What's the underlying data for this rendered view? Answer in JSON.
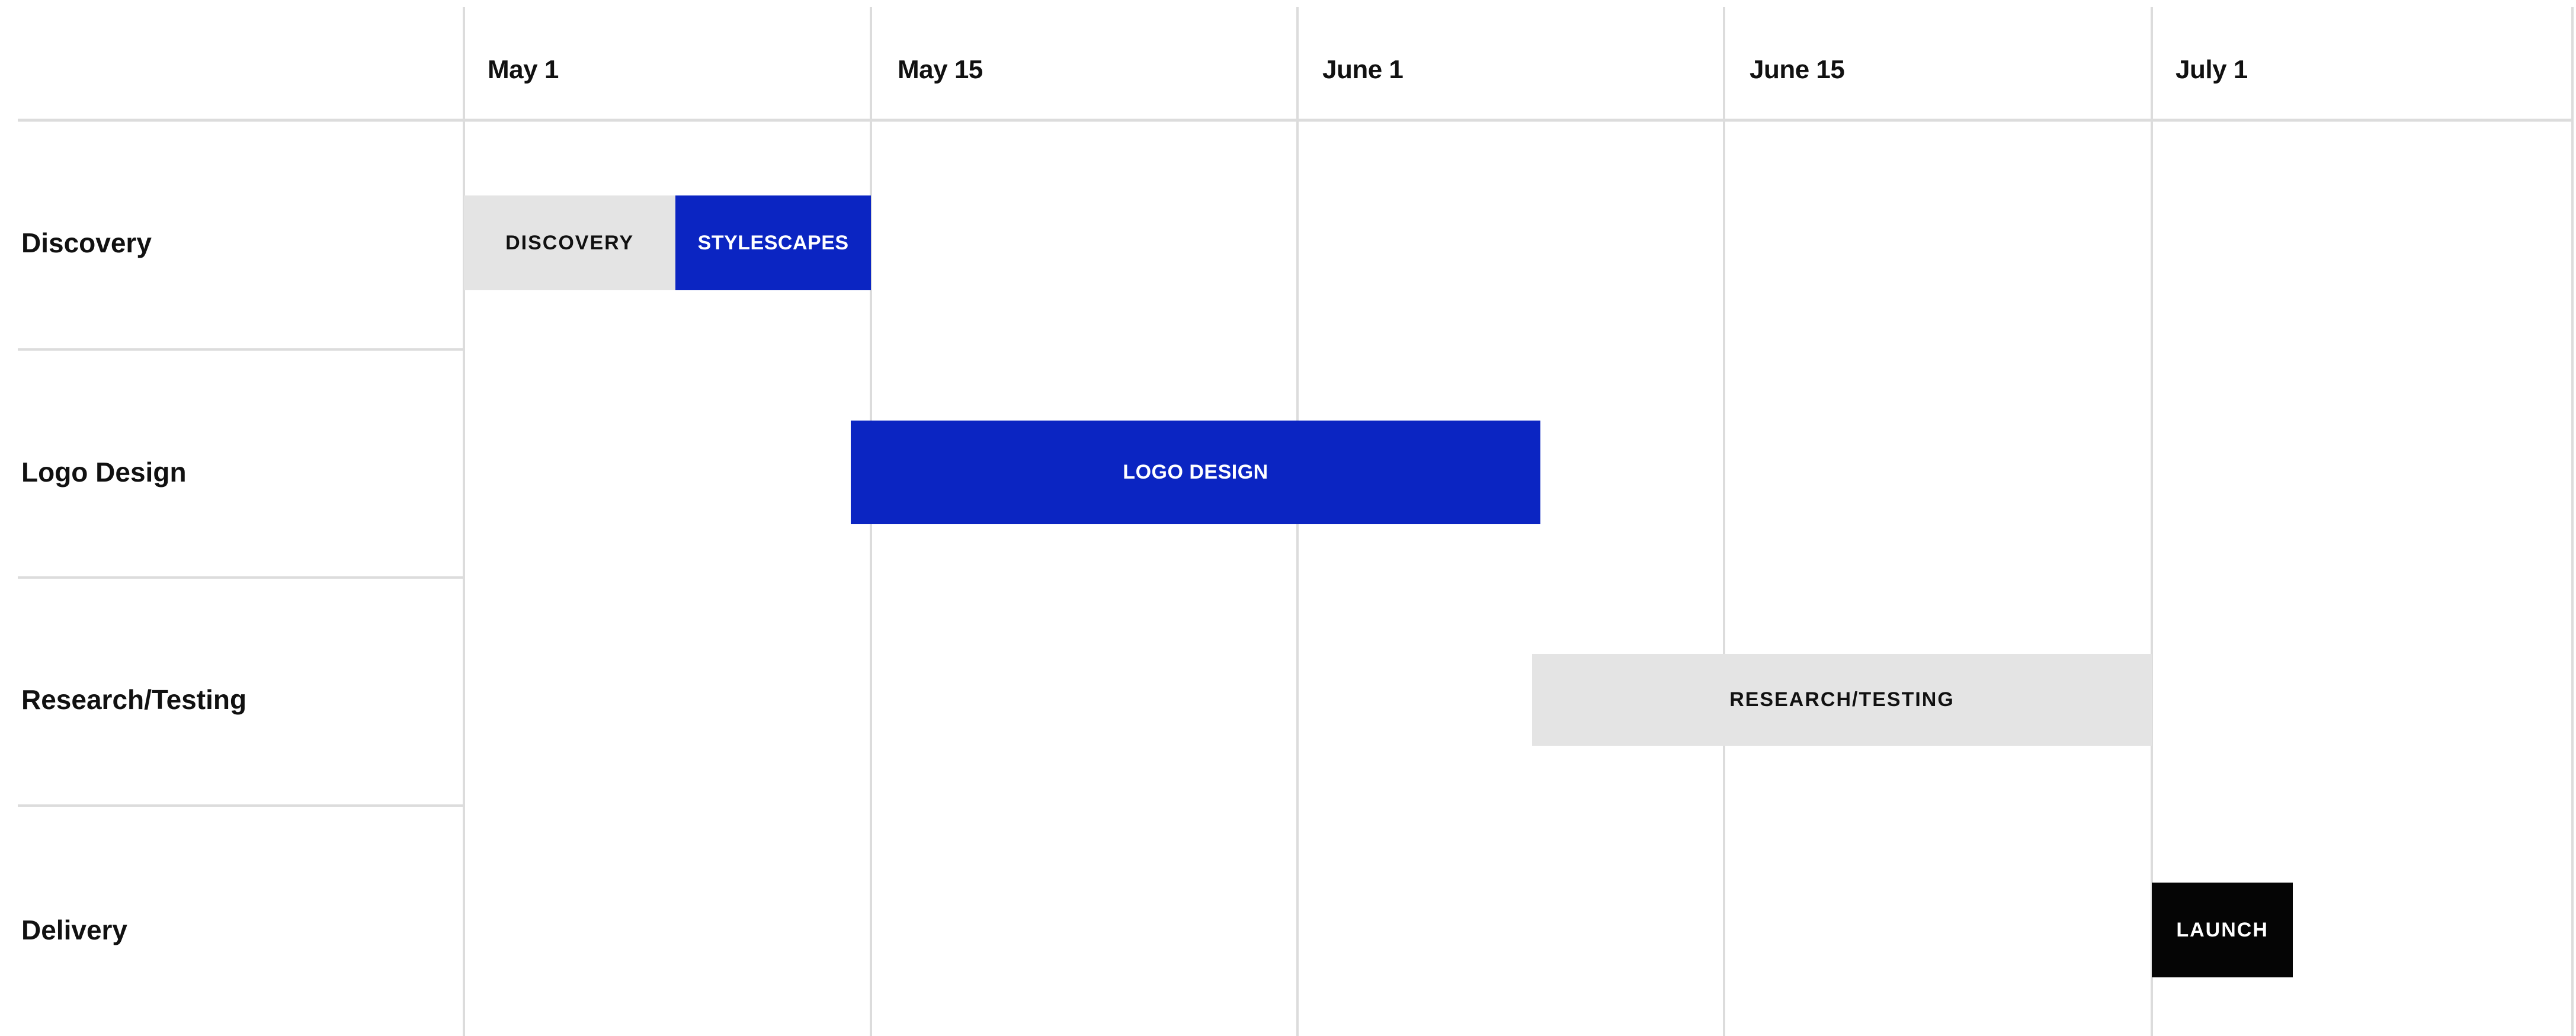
{
  "chart_data": {
    "type": "gantt",
    "x_ticks": [
      "May 1",
      "May 15",
      "June 1",
      "June 15",
      "July 1"
    ],
    "rows": [
      "Discovery",
      "Logo Design",
      "Research/Testing",
      "Delivery"
    ],
    "tasks": [
      {
        "label": "DISCOVERY",
        "row": 0,
        "start": 0.0,
        "end": 0.52,
        "color": "#e4e4e4",
        "text_color": "#111111"
      },
      {
        "label": "STYLESCAPES",
        "row": 0,
        "start": 0.52,
        "end": 1.0,
        "color": "#0b25c2",
        "text_color": "#ffffff"
      },
      {
        "label": "LOGO DESIGN",
        "row": 1,
        "start": 0.95,
        "end": 2.57,
        "color": "#0b25c2",
        "text_color": "#ffffff"
      },
      {
        "label": "RESEARCH/TESTING",
        "row": 2,
        "start": 2.55,
        "end": 4.0,
        "color": "#e4e4e4",
        "text_color": "#111111"
      },
      {
        "label": "LAUNCH",
        "row": 3,
        "start": 4.0,
        "end": 4.33,
        "color": "#050505",
        "text_color": "#ffffff"
      }
    ],
    "gridlines": true
  }
}
